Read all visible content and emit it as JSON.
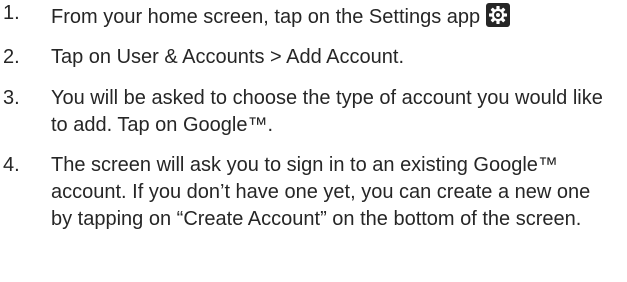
{
  "steps": [
    {
      "number": "1.",
      "text": "From your home screen, tap on the Settings app",
      "icon": "gear-icon"
    },
    {
      "number": "2.",
      "text": "Tap on User & Accounts > Add Account."
    },
    {
      "number": "3.",
      "text": "You will be asked to choose the type of account you would like to add. Tap on Google™."
    },
    {
      "number": "4.",
      "text": "The screen will ask you to sign in to an existing Google™ account. If you don’t have one yet, you can create a new one by tapping on “Create Account” on the bottom of the screen."
    }
  ]
}
